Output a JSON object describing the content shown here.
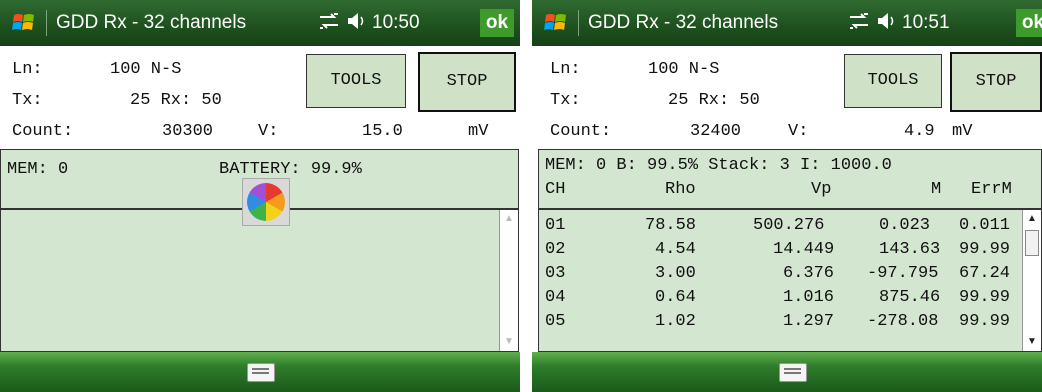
{
  "left": {
    "title": "GDD Rx - 32 channels",
    "time": "10:50",
    "ok": "ok",
    "ln_label": "Ln:",
    "ln_value": "100 N-S",
    "tx_label": "Tx:",
    "tx_value": "25 Rx: 50",
    "count_label": "Count:",
    "count_value": "30300",
    "v_label": "V:",
    "v_value": "15.0",
    "v_unit": "mV",
    "tools_label": "TOOLS",
    "stop_label": "STOP",
    "mem_text": "MEM: 0",
    "battery_text": "BATTERY: 99.9%"
  },
  "right": {
    "title": "GDD Rx - 32 channels",
    "time": "10:51",
    "ok": "ok",
    "ln_label": "Ln:",
    "ln_value": "100 N-S",
    "tx_label": "Tx:",
    "tx_value": "25 Rx: 50",
    "count_label": "Count:",
    "count_value": "32400",
    "v_label": "V:",
    "v_value": "4.9",
    "v_unit": "mV",
    "tools_label": "TOOLS",
    "stop_label": "STOP",
    "status_line": "MEM: 0 B: 99.5% Stack: 3 I: 1000.0",
    "columns": [
      "CH",
      "Rho",
      "Vp",
      "M",
      "ErrM"
    ],
    "rows": [
      [
        "01",
        "78.58",
        "500.276",
        "0.023",
        "0.011"
      ],
      [
        "02",
        "4.54",
        "14.449",
        "143.63",
        "99.99"
      ],
      [
        "03",
        "3.00",
        "6.376",
        "-97.795",
        "67.24"
      ],
      [
        "04",
        "0.64",
        "1.016",
        "875.46",
        "99.99"
      ],
      [
        "05",
        "1.02",
        "1.297",
        "-278.08",
        "99.99"
      ]
    ]
  },
  "icons": {
    "start": "windows-start-icon",
    "connectivity": "connectivity-icon",
    "volume": "volume-icon",
    "keyboard": "keyboard-icon",
    "busy": "busy-wheel-icon"
  }
}
